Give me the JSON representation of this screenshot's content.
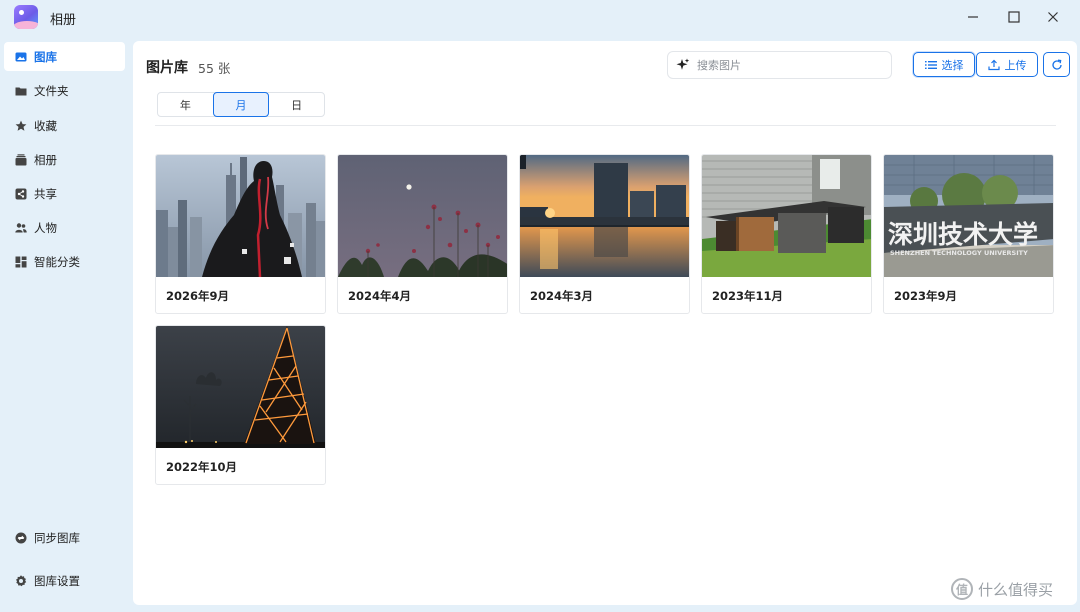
{
  "window": {
    "title": "相册",
    "controls": {
      "minimize_icon": "minimize-icon",
      "maximize_icon": "maximize-icon",
      "close_icon": "close-icon"
    }
  },
  "sidebar": {
    "items": [
      {
        "label": "图库",
        "icon": "gallery-icon",
        "active": true
      },
      {
        "label": "文件夹",
        "icon": "folder-icon"
      },
      {
        "label": "收藏",
        "icon": "star-icon"
      },
      {
        "label": "相册",
        "icon": "album-icon"
      },
      {
        "label": "共享",
        "icon": "share-icon"
      },
      {
        "label": "人物",
        "icon": "people-icon"
      },
      {
        "label": "智能分类",
        "icon": "category-icon"
      }
    ],
    "bottom": [
      {
        "label": "同步图库",
        "icon": "sync-icon"
      },
      {
        "label": "图库设置",
        "icon": "gear-icon"
      }
    ]
  },
  "header": {
    "title": "图片库",
    "count": "55 张",
    "search_placeholder": "搜索图片",
    "select_label": "选择",
    "upload_label": "上传"
  },
  "view_toggle": {
    "options": [
      "年",
      "月",
      "日"
    ],
    "selected": "月"
  },
  "albums": [
    {
      "label": "2026年9月",
      "scene": "city-skyline-person"
    },
    {
      "label": "2024年4月",
      "scene": "dusk-moon-flowers"
    },
    {
      "label": "2024年3月",
      "scene": "sunset-reflection-pool"
    },
    {
      "label": "2023年11月",
      "scene": "garden-benches"
    },
    {
      "label": "2023年9月",
      "scene": "university-sign"
    },
    {
      "label": "2022年10月",
      "scene": "night-lit-pyramid"
    }
  ],
  "thumb_text": {
    "sign_main": "深圳技术大学",
    "sign_sub": "SHENZHEN TECHNOLOGY UNIVERSITY"
  },
  "watermark": "什么值得买",
  "colors": {
    "accent": "#1a73e8",
    "sidebar_bg": "#e4f0f9"
  }
}
